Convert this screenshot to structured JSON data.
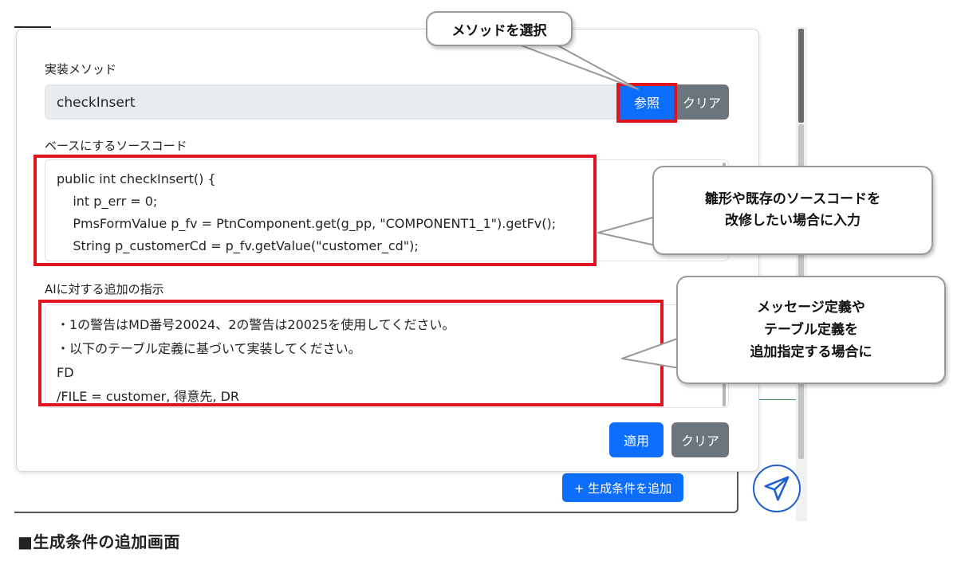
{
  "dialog": {
    "method_label": "実装メソッド",
    "method_value": "checkInsert",
    "ref_button": "参照",
    "method_clear_button": "クリア",
    "base_code_label": "ベースにするソースコード",
    "base_code_lines": [
      "public int checkInsert() {",
      "    int p_err = 0;",
      "    PmsFormValue p_fv = PtnComponent.get(g_pp, \"COMPONENT1_1\").getFv();",
      "    String p_customerCd = p_fv.getValue(\"customer_cd\");"
    ],
    "ai_instr_label": "AIに対する追加の指示",
    "ai_instr_lines": [
      "・1の警告はMD番号20024、2の警告は20025を使用してください。",
      "・以下のテーブル定義に基づいて実装してください。",
      "FD",
      "/FILE = customer, 得意先, DR"
    ],
    "apply_button": "適用",
    "apply_clear_button": "クリア"
  },
  "background": {
    "add_condition_button": "+ 生成条件を追加",
    "send_icon": "paper-plane-icon"
  },
  "callouts": {
    "select_method": "メソッドを選択",
    "modify_source": [
      "雛形や既存のソースコードを",
      "改修したい場合に入力"
    ],
    "add_definitions": [
      "メッセージ定義や",
      "テーブル定義を",
      "追加指定する場合に"
    ]
  },
  "caption": "■生成条件の追加画面",
  "colors": {
    "primary": "#0d6efd",
    "secondary": "#6c757d",
    "highlight_red": "#e0141e"
  }
}
